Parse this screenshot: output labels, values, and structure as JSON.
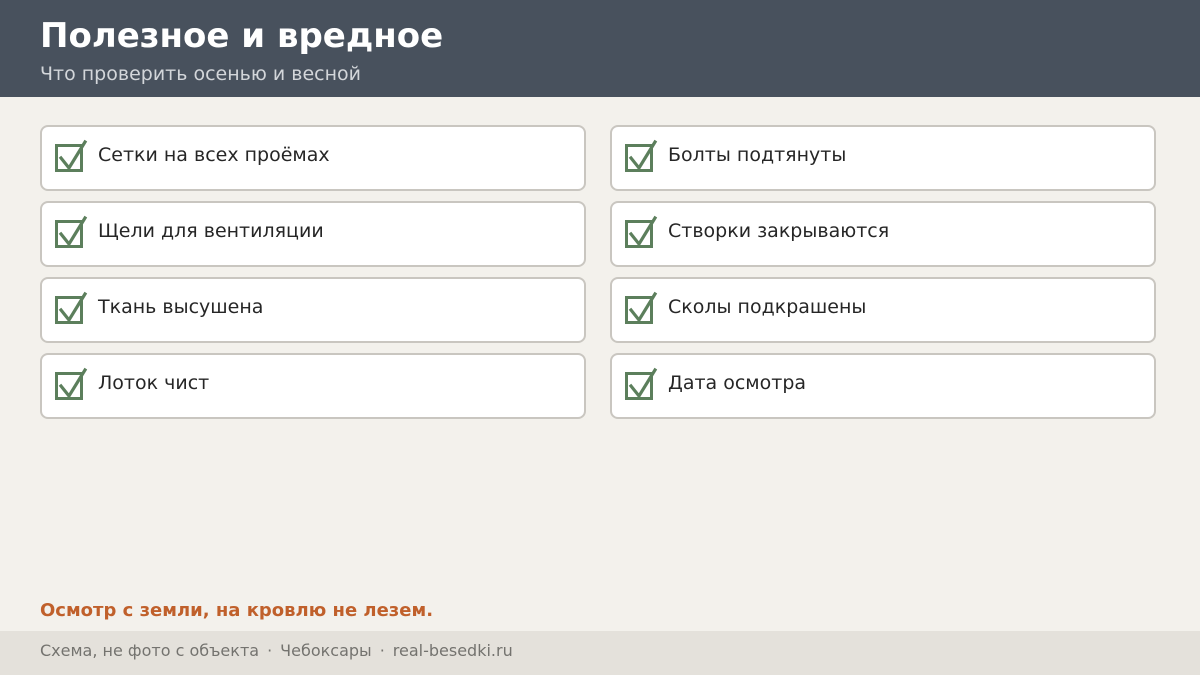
{
  "header": {
    "title": "Полезное и вредное",
    "subtitle": "Что проверить осенью и весной"
  },
  "checklist": {
    "left": [
      {
        "label": "Сетки на всех проёмах",
        "checked": true
      },
      {
        "label": "Щели для вентиляции",
        "checked": true
      },
      {
        "label": "Ткань высушена",
        "checked": true
      },
      {
        "label": "Лоток чист",
        "checked": true
      }
    ],
    "right": [
      {
        "label": "Болты подтянуты",
        "checked": true
      },
      {
        "label": "Створки закрываются",
        "checked": true
      },
      {
        "label": "Сколы подкрашены",
        "checked": true
      },
      {
        "label": "Дата осмотра",
        "checked": true
      }
    ],
    "check_icon": "checkmark-icon"
  },
  "warning": "Осмотр с земли, на кровлю не лезем.",
  "footer": {
    "note": "Схема, не фото с объекта",
    "separator": "·",
    "city": "Чебоксары",
    "site": "real-besedki.ru"
  },
  "colors": {
    "header_bg": "#48515d",
    "page_bg": "#f3f1ec",
    "check_green": "#5c7f5c",
    "warning_orange": "#c0602b",
    "footer_bg": "#e4e1db"
  }
}
